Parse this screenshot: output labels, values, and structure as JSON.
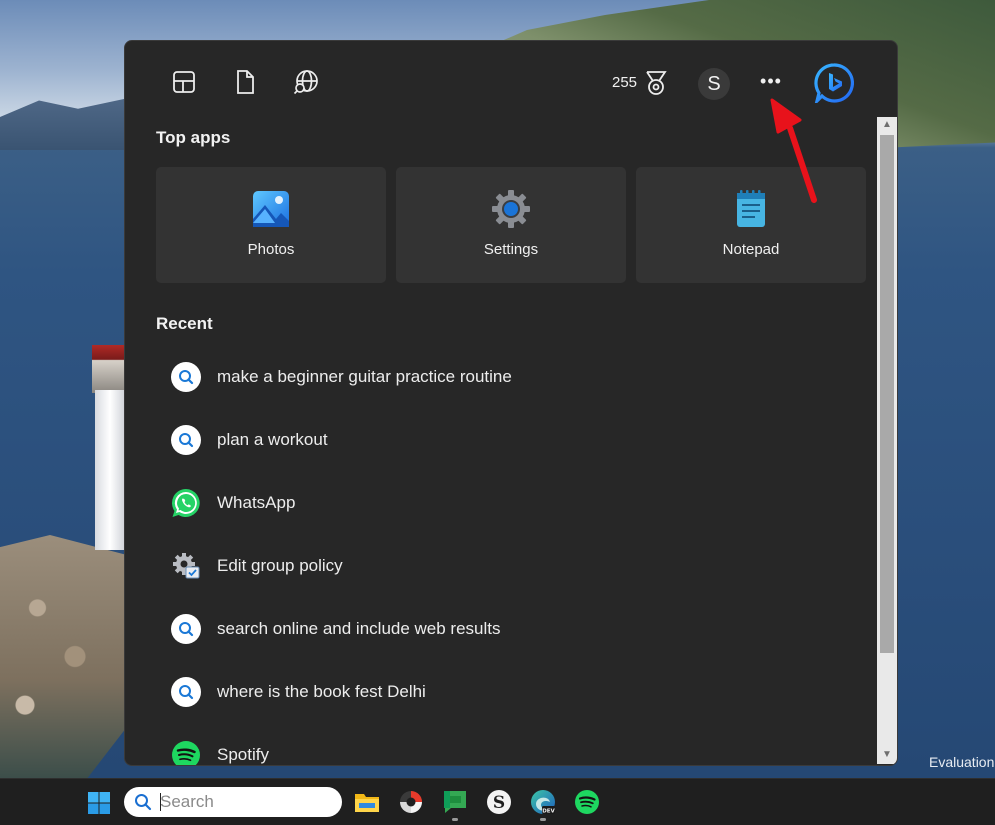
{
  "desktop": {
    "watermark": "Evaluation"
  },
  "search_panel": {
    "toolbar": {
      "widgets_icon": "widgets-icon",
      "documents_icon": "document-icon",
      "web_icon": "globe-search-icon",
      "rewards_points": "255",
      "rewards_icon": "trophy-icon",
      "avatar_letter": "S",
      "more_label": "•••",
      "bing_icon": "bing-icon"
    },
    "top_apps": {
      "title": "Top apps",
      "items": [
        {
          "label": "Photos",
          "icon": "photos-icon"
        },
        {
          "label": "Settings",
          "icon": "settings-gear-icon"
        },
        {
          "label": "Notepad",
          "icon": "notepad-icon"
        }
      ]
    },
    "recent": {
      "title": "Recent",
      "items": [
        {
          "label": "make a beginner guitar practice routine",
          "icon": "search-icon"
        },
        {
          "label": "plan a workout",
          "icon": "search-icon"
        },
        {
          "label": "WhatsApp",
          "icon": "whatsapp-icon"
        },
        {
          "label": "Edit group policy",
          "icon": "group-policy-icon"
        },
        {
          "label": "search online and include web results",
          "icon": "search-icon"
        },
        {
          "label": "where is the book fest Delhi",
          "icon": "search-icon"
        },
        {
          "label": "Spotify",
          "icon": "spotify-icon"
        }
      ]
    }
  },
  "taskbar": {
    "start_icon": "windows-start-icon",
    "search_placeholder": "Search",
    "apps": [
      {
        "name": "file-explorer-icon"
      },
      {
        "name": "davinci-resolve-icon"
      },
      {
        "name": "google-chat-icon"
      },
      {
        "name": "simplenote-icon"
      },
      {
        "name": "edge-dev-icon"
      },
      {
        "name": "spotify-icon"
      }
    ]
  },
  "colors": {
    "panel_bg": "#272727",
    "tile_bg": "#333333",
    "accent_blue": "#0a84ff",
    "annotation_red": "#e8121b"
  }
}
